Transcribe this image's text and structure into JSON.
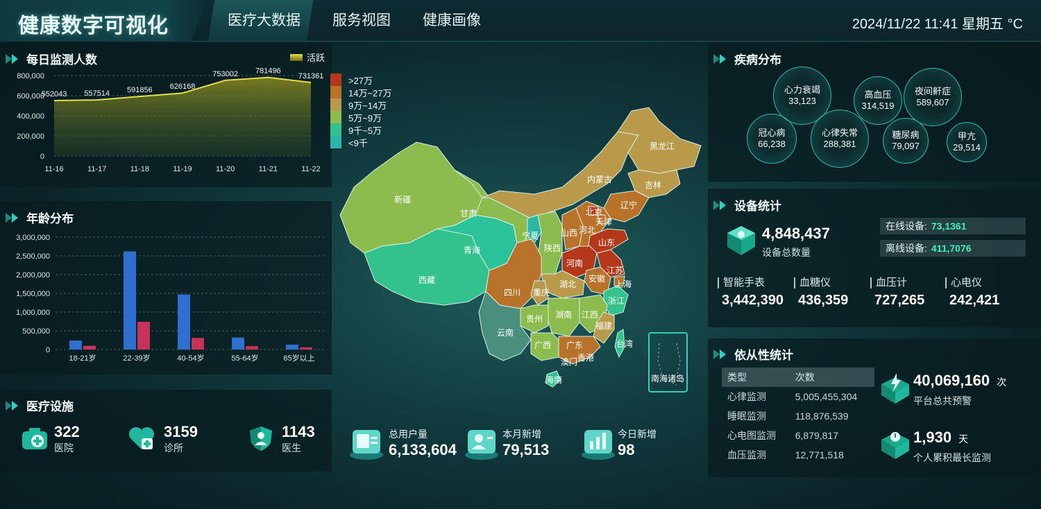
{
  "header": {
    "title": "健康数字可视化",
    "tabs": [
      {
        "label": "医疗大数据",
        "active": true
      },
      {
        "label": "服务视图"
      },
      {
        "label": "健康画像"
      }
    ],
    "datetime": "2024/11/22 11:41 星期五 °C"
  },
  "daily": {
    "title": "每日监测人数",
    "legend": "活跃",
    "chart_data": {
      "type": "area",
      "x": [
        "11-16",
        "11-17",
        "11-18",
        "11-19",
        "11-20",
        "11-21",
        "11-22"
      ],
      "series": [
        {
          "name": "活跃",
          "values": [
            552043,
            557514,
            591856,
            626168,
            753002,
            781496,
            731361
          ]
        }
      ],
      "ylim": [
        0,
        800000
      ],
      "yticks": [
        "0",
        "200,000",
        "400,000",
        "600,000",
        "800,000"
      ],
      "data_labels": [
        "552043",
        "557514",
        "591856",
        "626168",
        "753002",
        "781496",
        "731361"
      ],
      "color": "#e6e14a"
    }
  },
  "age": {
    "title": "年龄分布",
    "chart_data": {
      "type": "bar",
      "categories": [
        "18-21岁",
        "22-39岁",
        "40-54岁",
        "55-64岁",
        "65岁以上"
      ],
      "series": [
        {
          "values": [
            240000,
            2620000,
            1470000,
            320000,
            130000
          ],
          "color": "#2f6fd0"
        },
        {
          "values": [
            100000,
            740000,
            310000,
            90000,
            60000
          ],
          "color": "#c8325a"
        }
      ],
      "ylim": [
        0,
        3000000
      ],
      "yticks": [
        "0",
        "500,000",
        "1,000,000",
        "1,500,000",
        "2,000,000",
        "2,500,000",
        "3,000,000"
      ]
    }
  },
  "facilities": {
    "title": "医疗设施",
    "items": [
      {
        "value": "322",
        "label": "医院",
        "icon": "hospital-icon"
      },
      {
        "value": "3159",
        "label": "诊所",
        "icon": "clinic-icon"
      },
      {
        "value": "1143",
        "label": "医生",
        "icon": "doctor-icon"
      }
    ]
  },
  "users": {
    "items": [
      {
        "label": "总用户量",
        "value": "6,133,604"
      },
      {
        "label": "本月新增",
        "value": "79,513"
      },
      {
        "label": "今日新增",
        "value": "98"
      }
    ]
  },
  "map": {
    "legend": [
      {
        "label": ">27万",
        "color": "#b5381a"
      },
      {
        "label": "14万~27万",
        "color": "#b8722a"
      },
      {
        "label": "9万~14万",
        "color": "#b99a4a"
      },
      {
        "label": "5万~9万",
        "color": "#8cbc4e"
      },
      {
        "label": "9千~5万",
        "color": "#33c28e"
      },
      {
        "label": "<9千",
        "color": "#2bb6a8"
      }
    ],
    "provinces": [
      "新疆",
      "西藏",
      "青海",
      "甘肃",
      "宁夏",
      "内蒙古",
      "黑龙江",
      "吉林",
      "辽宁",
      "北京",
      "天津",
      "河北",
      "山西",
      "陕西",
      "山东",
      "河南",
      "江苏",
      "安徽",
      "上海",
      "湖北",
      "四川",
      "重庆",
      "浙江",
      "贵州",
      "湖南",
      "江西",
      "福建",
      "云南",
      "广西",
      "广东",
      "澳门",
      "香港",
      "台湾",
      "海南",
      "南海诸岛"
    ]
  },
  "disease": {
    "title": "疾病分布",
    "items": [
      {
        "name": "心力衰竭",
        "value": "33,123"
      },
      {
        "name": "高血压",
        "value": "314,519"
      },
      {
        "name": "夜间鼾症",
        "value": "589,607"
      },
      {
        "name": "冠心病",
        "value": "66,238"
      },
      {
        "name": "心律失常",
        "value": "288,381"
      },
      {
        "name": "糖尿病",
        "value": "79,097"
      },
      {
        "name": "甲亢",
        "value": "29,514"
      }
    ]
  },
  "devices": {
    "title": "设备统计",
    "total": "4,848,437",
    "total_label": "设备总数量",
    "online_label": "在线设备:",
    "online": "73,1361",
    "offline_label": "离线设备:",
    "offline": "411,7076",
    "types": [
      {
        "name": "智能手表",
        "value": "3,442,390"
      },
      {
        "name": "血糖仪",
        "value": "436,359"
      },
      {
        "name": "血压计",
        "value": "727,265"
      },
      {
        "name": "心电仪",
        "value": "242,421"
      }
    ]
  },
  "compliance": {
    "title": "依从性统计",
    "columns": [
      "类型",
      "次数"
    ],
    "rows": [
      [
        "心律监测",
        "5,005,455,304"
      ],
      [
        "睡眠监测",
        "118,876,539"
      ],
      [
        "心电图监测",
        "6,879,817"
      ],
      [
        "血压监测",
        "12,771,518"
      ]
    ],
    "alerts_value": "40,069,160",
    "alerts_unit": "次",
    "alerts_label": "平台总共预警",
    "longest_value": "1,930",
    "longest_unit": "天",
    "longest_label": "个人累积最长监测"
  }
}
